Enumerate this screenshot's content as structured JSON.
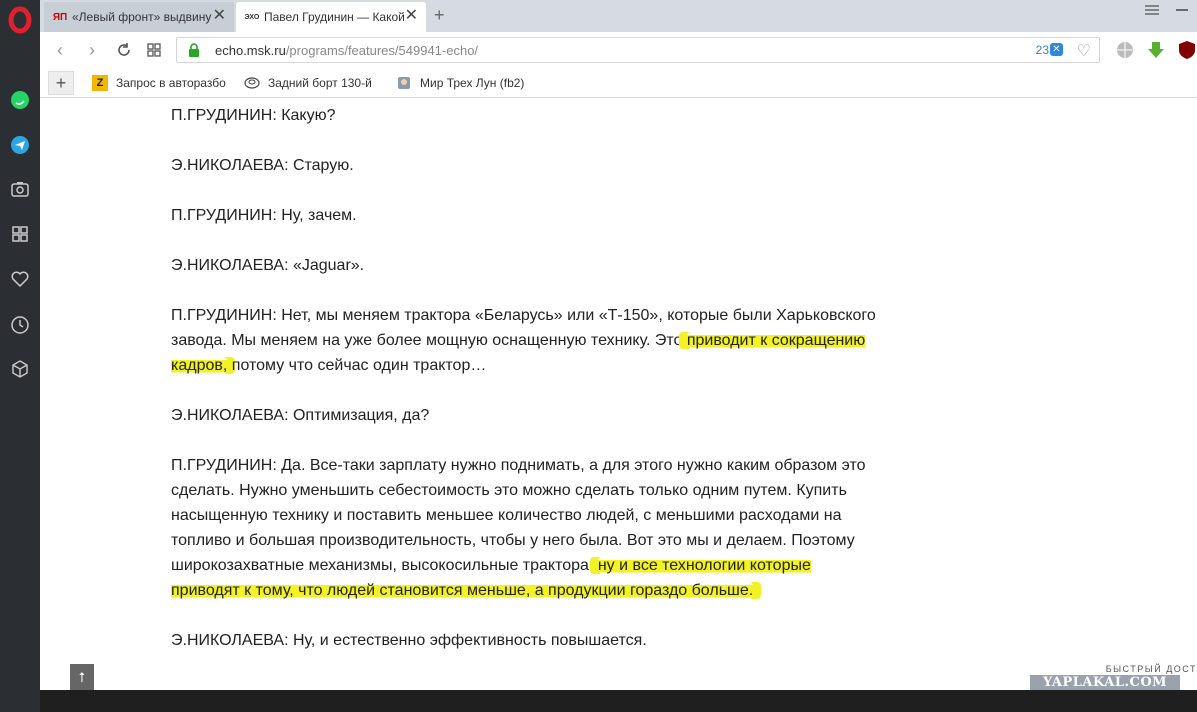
{
  "tabs": [
    {
      "title": "«Левый фронт» выдвину",
      "favicon": "ЯП"
    },
    {
      "title": "Павел Грудинин — Какой",
      "favicon": "ЭХО"
    }
  ],
  "address": {
    "host": "echo.msk.ru",
    "path": "/programs/features/549941-echo/",
    "badge_count": "23"
  },
  "bookmarks": [
    {
      "label": "Запрос в авторазбо",
      "icon": "Z"
    },
    {
      "label": "Задний борт 130-й",
      "icon": "toyota-icon"
    },
    {
      "label": "Мир Трех Лун (fb2)",
      "icon": "book-icon"
    }
  ],
  "article": {
    "p1": "П.ГРУДИНИН: Какую?",
    "p2": "Э.НИКОЛАЕВА: Старую.",
    "p3": "П.ГРУДИНИН: Ну, зачем.",
    "p4": "Э.НИКОЛАЕВА: «Jaguar».",
    "p5_a": "П.ГРУДИНИН: Нет, мы меняем трактора «Беларусь» или «Т-150», которые были Харьковского завода. Мы меняем на уже более мощную оснащенную технику. Это ",
    "p5_hl": "приводит к сокращению кадров,",
    "p5_b": " потому что сейчас один трактор…",
    "p6": "Э.НИКОЛАЕВА: Оптимизация, да?",
    "p7_a": "П.ГРУДИНИН: Да. Все-таки зарплату нужно поднимать, а для этого нужно каким образом это сделать. Нужно уменьшить себестоимость это можно сделать только одним путем. Купить насыщенную технику и поставить меньшее количество людей, с меньшими расходами на топливо и большая производительность, чтобы у него была. Вот это мы и делаем. Поэтому широкозахватные механизмы, высокосильные трактора, ",
    "p7_hl": "ну и все технологии которые приводят к тому, что людей становится меньше, а продукции гораздо больше.",
    "p8": "Э.НИКОЛАЕВА: Ну, и естественно эффективность повышается."
  },
  "speed_dial_label": "БЫСТРЫЙ ДОСТ",
  "watermark": "YAPLAKAL.COM",
  "colors": {
    "highlight": "#f2f224",
    "sidebar": "#2b2e33"
  }
}
